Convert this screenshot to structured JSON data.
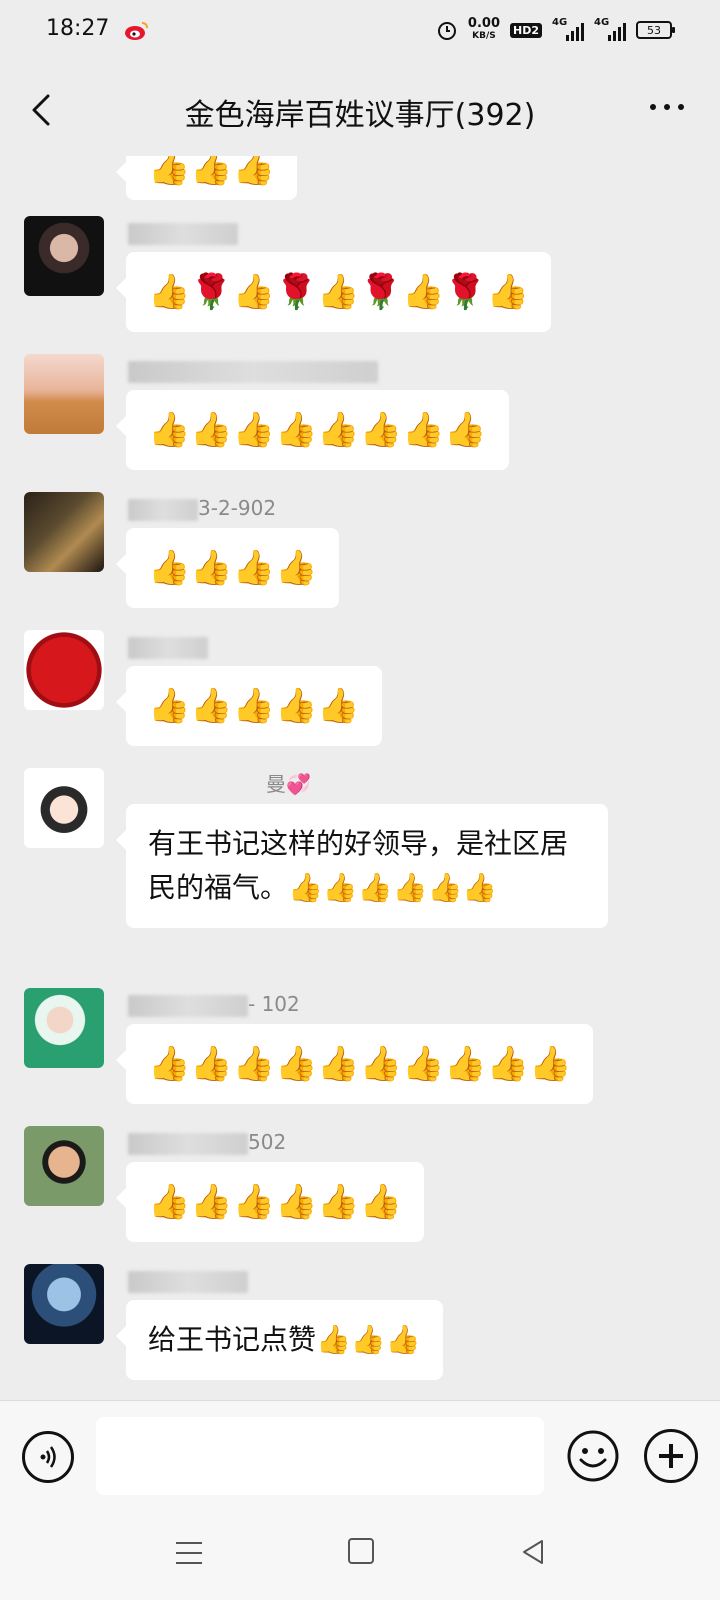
{
  "status_bar": {
    "time": "18:27",
    "net_speed_value": "0.00",
    "net_speed_unit": "KB/S",
    "hd_label": "HD2",
    "signal1_label": "4G",
    "signal2_label": "4G",
    "battery": "53",
    "icons": [
      "weibo-icon",
      "alarm-icon",
      "signal-icon",
      "battery-icon"
    ]
  },
  "header": {
    "title": "金色海岸百姓议事厅(392)",
    "back_icon": "chevron-left-icon",
    "more_icon": "more-dots-icon"
  },
  "messages": [
    {
      "sender_visible": "",
      "text": "👍👍👍",
      "partial": true
    },
    {
      "sender_visible": "",
      "text": "👍🌹👍🌹👍🌹👍🌹👍"
    },
    {
      "sender_visible": "",
      "text": "👍👍👍👍👍👍👍👍"
    },
    {
      "sender_visible": "3-2-902",
      "text": "👍👍👍👍"
    },
    {
      "sender_visible": "",
      "text": "👍👍👍👍👍"
    },
    {
      "sender_visible": "曼💞",
      "text": "有王书记这样的好领导，是社区居民的福气。👍👍👍👍👍👍"
    },
    {
      "sender_visible": "- 102",
      "text": "👍👍👍👍👍👍👍👍👍👍"
    },
    {
      "sender_visible": "502",
      "text": "👍👍👍👍👍👍"
    },
    {
      "sender_visible": "",
      "text": "给王书记点赞👍👍👍"
    }
  ],
  "input": {
    "value": "",
    "placeholder": ""
  },
  "colors": {
    "background": "#ededed",
    "bubble": "#ffffff",
    "sender_text": "#8a8a8a"
  }
}
